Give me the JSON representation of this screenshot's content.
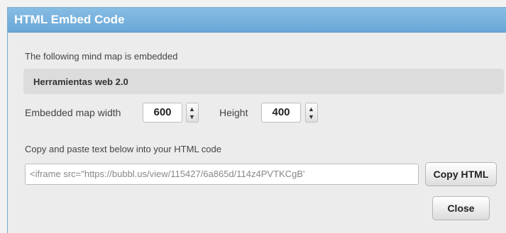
{
  "dialog": {
    "title": "HTML Embed Code",
    "description": "The following mind map is embedded",
    "map_name": "Herramientas web 2.0",
    "width_label": "Embedded map width",
    "width_value": "600",
    "height_label": "Height",
    "height_value": "400",
    "copy_instructions": "Copy and paste text below into your HTML code",
    "embed_code": "<iframe src=\"https://bubbl.us/view/115427/6a865d/114z4PVTKCgB'",
    "copy_button_label": "Copy HTML",
    "close_button_label": "Close"
  },
  "icons": {
    "spinner_up": "caret-up-icon",
    "spinner_down": "caret-down-icon"
  },
  "colors": {
    "titlebar": "#7ab3df",
    "dialog_bg": "#ececec"
  }
}
